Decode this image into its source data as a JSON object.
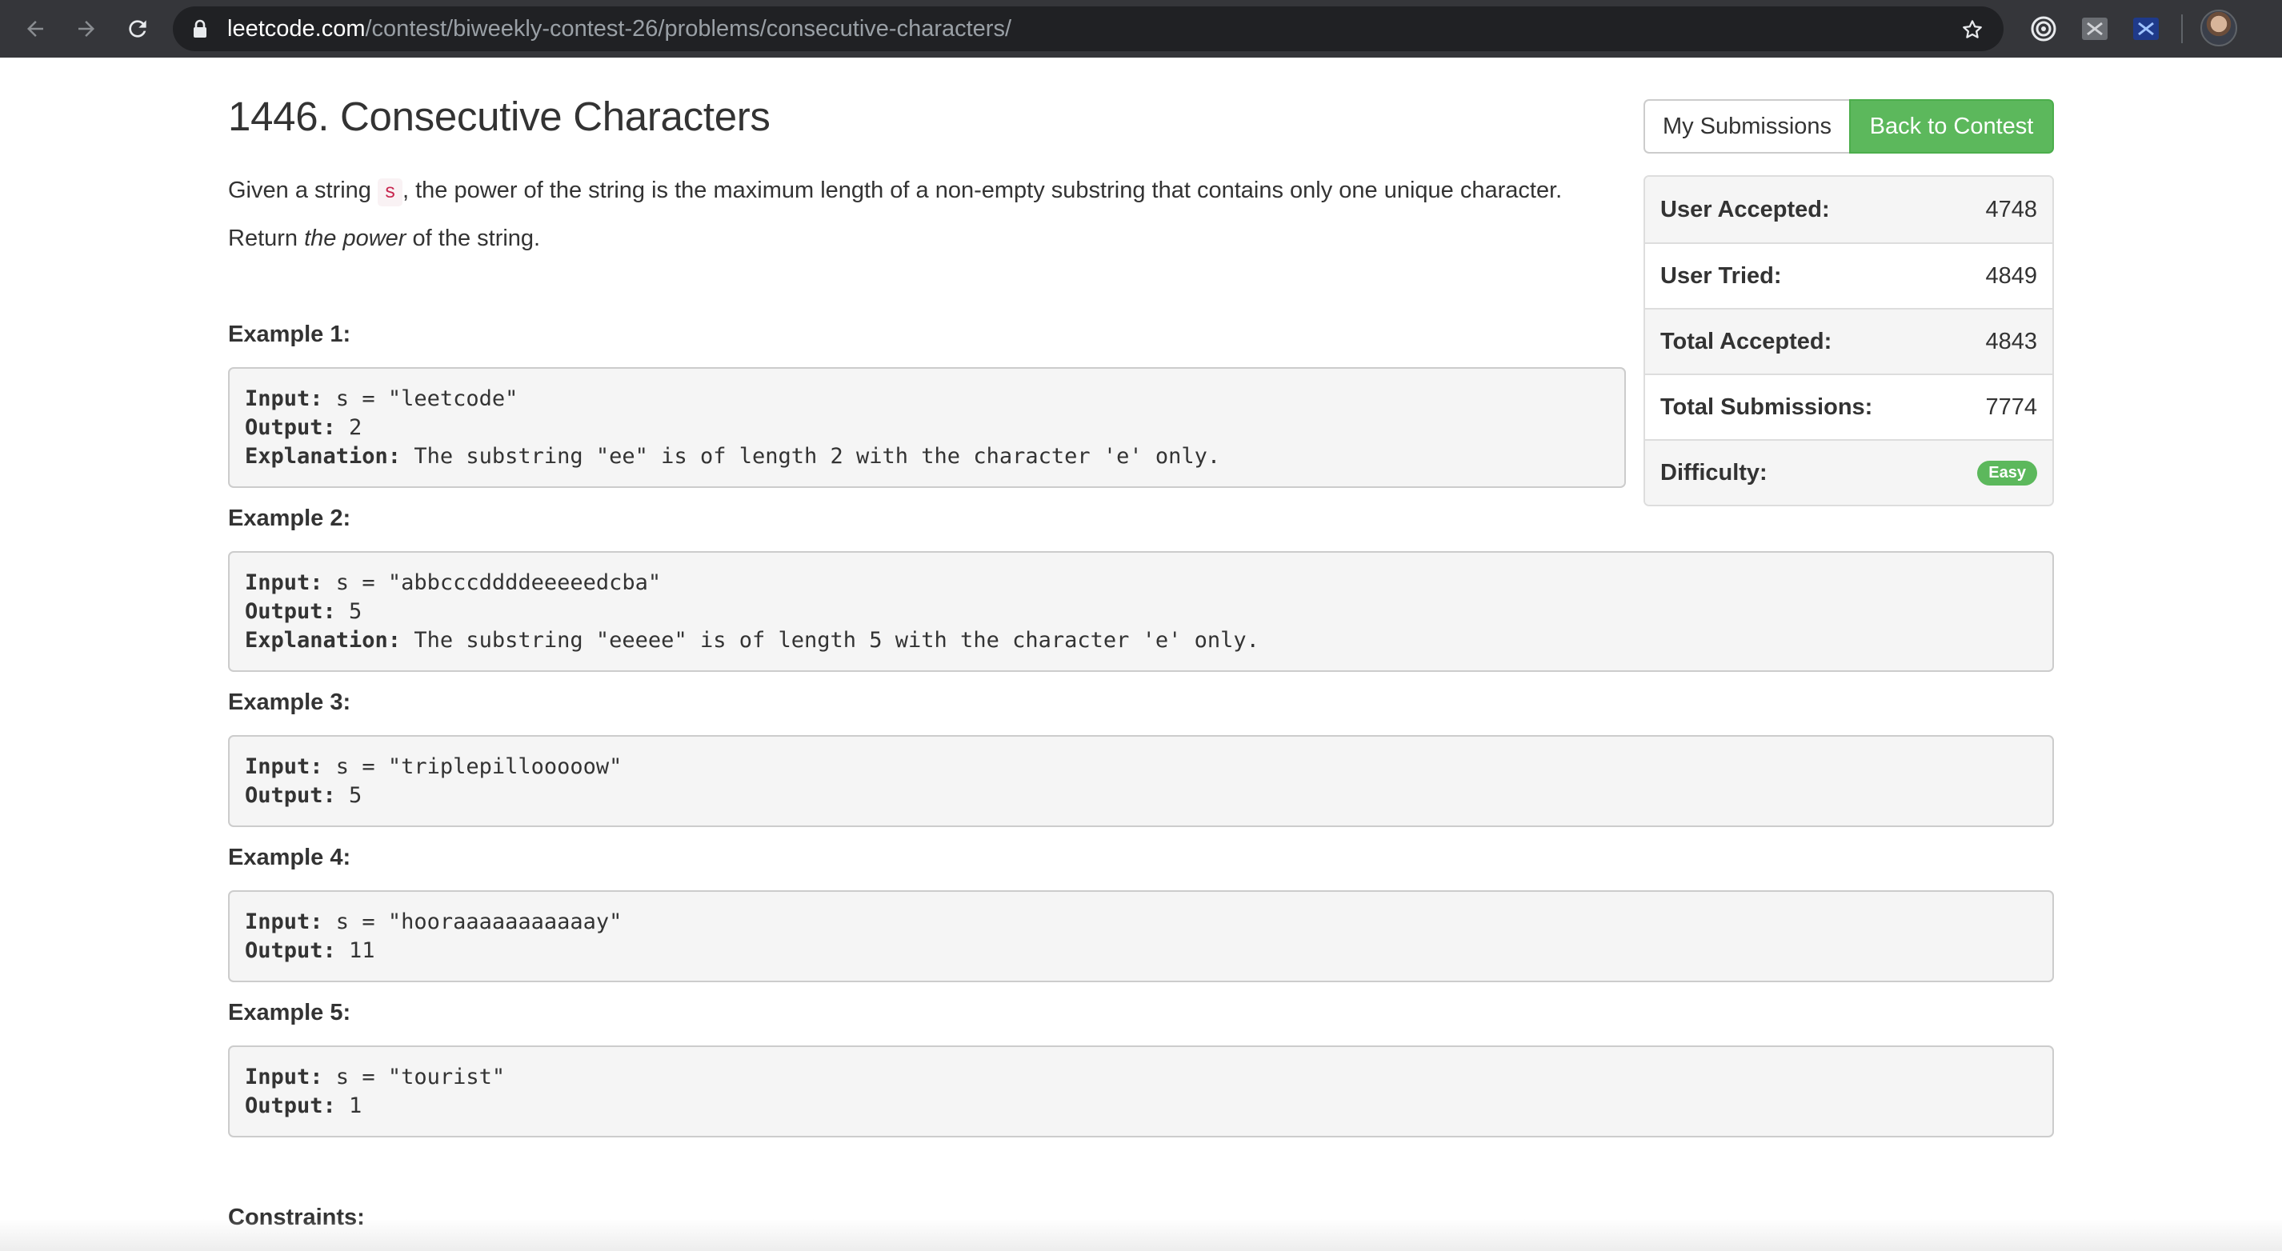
{
  "browser": {
    "url_host": "leetcode.com",
    "url_path": "/contest/biweekly-contest-26/problems/consecutive-characters/"
  },
  "problem": {
    "title": "1446. Consecutive Characters",
    "desc_before": "Given a string ",
    "desc_code": "s",
    "desc_after": ", the power of the string is the maximum length of a non-empty substring that contains only one unique character.",
    "return_before": "Return ",
    "return_em": "the power",
    "return_after": " of the string."
  },
  "labels": {
    "input": "Input:",
    "output": "Output:",
    "explanation": "Explanation:"
  },
  "examples": [
    {
      "heading": "Example 1:",
      "input": " s = \"leetcode\"",
      "output": " 2",
      "explanation": " The substring \"ee\" is of length 2 with the character 'e' only."
    },
    {
      "heading": "Example 2:",
      "input": " s = \"abbcccddddeeeeedcba\"",
      "output": " 5",
      "explanation": " The substring \"eeeee\" is of length 5 with the character 'e' only."
    },
    {
      "heading": "Example 3:",
      "input": " s = \"triplepillooooow\"",
      "output": " 5"
    },
    {
      "heading": "Example 4:",
      "input": " s = \"hooraaaaaaaaaaay\"",
      "output": " 11"
    },
    {
      "heading": "Example 5:",
      "input": " s = \"tourist\"",
      "output": " 1"
    }
  ],
  "constraints_heading": "Constraints:",
  "actions": {
    "my_submissions": "My Submissions",
    "back_to_contest": "Back to Contest"
  },
  "stats": [
    {
      "label": "User Accepted:",
      "value": "4748"
    },
    {
      "label": "User Tried:",
      "value": "4849"
    },
    {
      "label": "Total Accepted:",
      "value": "4843"
    },
    {
      "label": "Total Submissions:",
      "value": "7774"
    },
    {
      "label": "Difficulty:",
      "value": "Easy"
    }
  ],
  "colors": {
    "success": "#5cb85c",
    "code_text": "#c7254e",
    "chrome_bg": "#35363a"
  },
  "icons": [
    "back-arrow-icon",
    "forward-arrow-icon",
    "reload-icon",
    "lock-icon",
    "star-icon",
    "target-extension-icon",
    "extension-icon",
    "extension-icon-blue",
    "profile-avatar"
  ]
}
